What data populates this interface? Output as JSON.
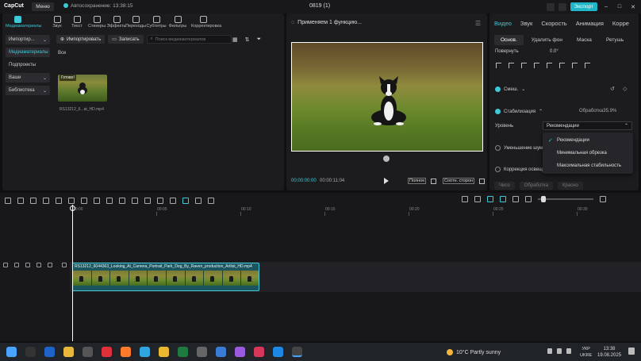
{
  "app": {
    "logo": "CapCut",
    "menu_label": "Меню",
    "autosave": "Автосохранение: 13:38:15",
    "project_title": "0819 (1)",
    "export_label": "Экспорт",
    "accent": "#3ec8d8"
  },
  "media_tabs": [
    {
      "label": "Медиаматериалы",
      "icon": "media-icon"
    },
    {
      "label": "Звук",
      "icon": "music-icon"
    },
    {
      "label": "Текст",
      "icon": "text-icon"
    },
    {
      "label": "Стикеры",
      "icon": "sticker-icon"
    },
    {
      "label": "Эффекты",
      "icon": "effects-icon"
    },
    {
      "label": "Переходы",
      "icon": "transitions-icon"
    },
    {
      "label": "Субтитры",
      "icon": "subtitles-icon"
    },
    {
      "label": "Фильтры",
      "icon": "filters-icon"
    },
    {
      "label": "Корректировка",
      "icon": "adjust-icon"
    }
  ],
  "sidenav": [
    {
      "label": "Импортир..."
    },
    {
      "label": "Медиаматериалы"
    },
    {
      "label": "Подпроекты"
    },
    {
      "label": "Ваши"
    },
    {
      "label": "Библиотека"
    }
  ],
  "media": {
    "import_label": "Импортировать",
    "record_label": "Записать",
    "search_placeholder": "Поиск медиаматериалов",
    "all_label": "Все",
    "clip_badge": "Готово!",
    "clip_name": "RS13212_6...at_HD.mp4"
  },
  "player": {
    "status": "Применяем 1 функцию...",
    "time_current": "00:00:00:00",
    "time_total": "00:00:11:04",
    "full_label": "Полное",
    "ratio_label": "Соотн. сторон"
  },
  "inspector": {
    "tabs": [
      "Видео",
      "Звук",
      "Скорость",
      "Анимация",
      "Корре"
    ],
    "subtabs": [
      "Основ.",
      "Удалить фон",
      "Маска",
      "Ретушь"
    ],
    "rotate_label": "Повернуть",
    "rotate_value": "0.0°",
    "mix_label": "Смеш.",
    "stab_label": "Стабилизация",
    "stab_status": "Обработка35.9%",
    "level_label": "Уровень",
    "level_value": "Рекомендации",
    "noise_label": "Уменьшение шума",
    "light_label": "Коррекция освещ",
    "bottom_buttons": [
      "Чисо",
      "Обработка",
      "Красно"
    ]
  },
  "dropdown": {
    "options": [
      "Рекомендации",
      "Минимальная обрезка",
      "Максимальная стабильность"
    ],
    "selected_index": 0
  },
  "timeline": {
    "ticks": [
      "00:00",
      "00:05",
      "00:10",
      "00:15",
      "00:20",
      "00:25",
      "00:30"
    ],
    "clip_title": "RS13212_6044363_Looking_At_Camera_Portrait_Park_Dog_By_Raven_production_Artlist_HD.mp4",
    "frame_count": 10
  },
  "taskbar": {
    "weather": "10°C  Partly sunny",
    "lang_line1": "УКР",
    "lang_line2": "UKRE",
    "time": "13:38",
    "date": "19.08.2025"
  }
}
